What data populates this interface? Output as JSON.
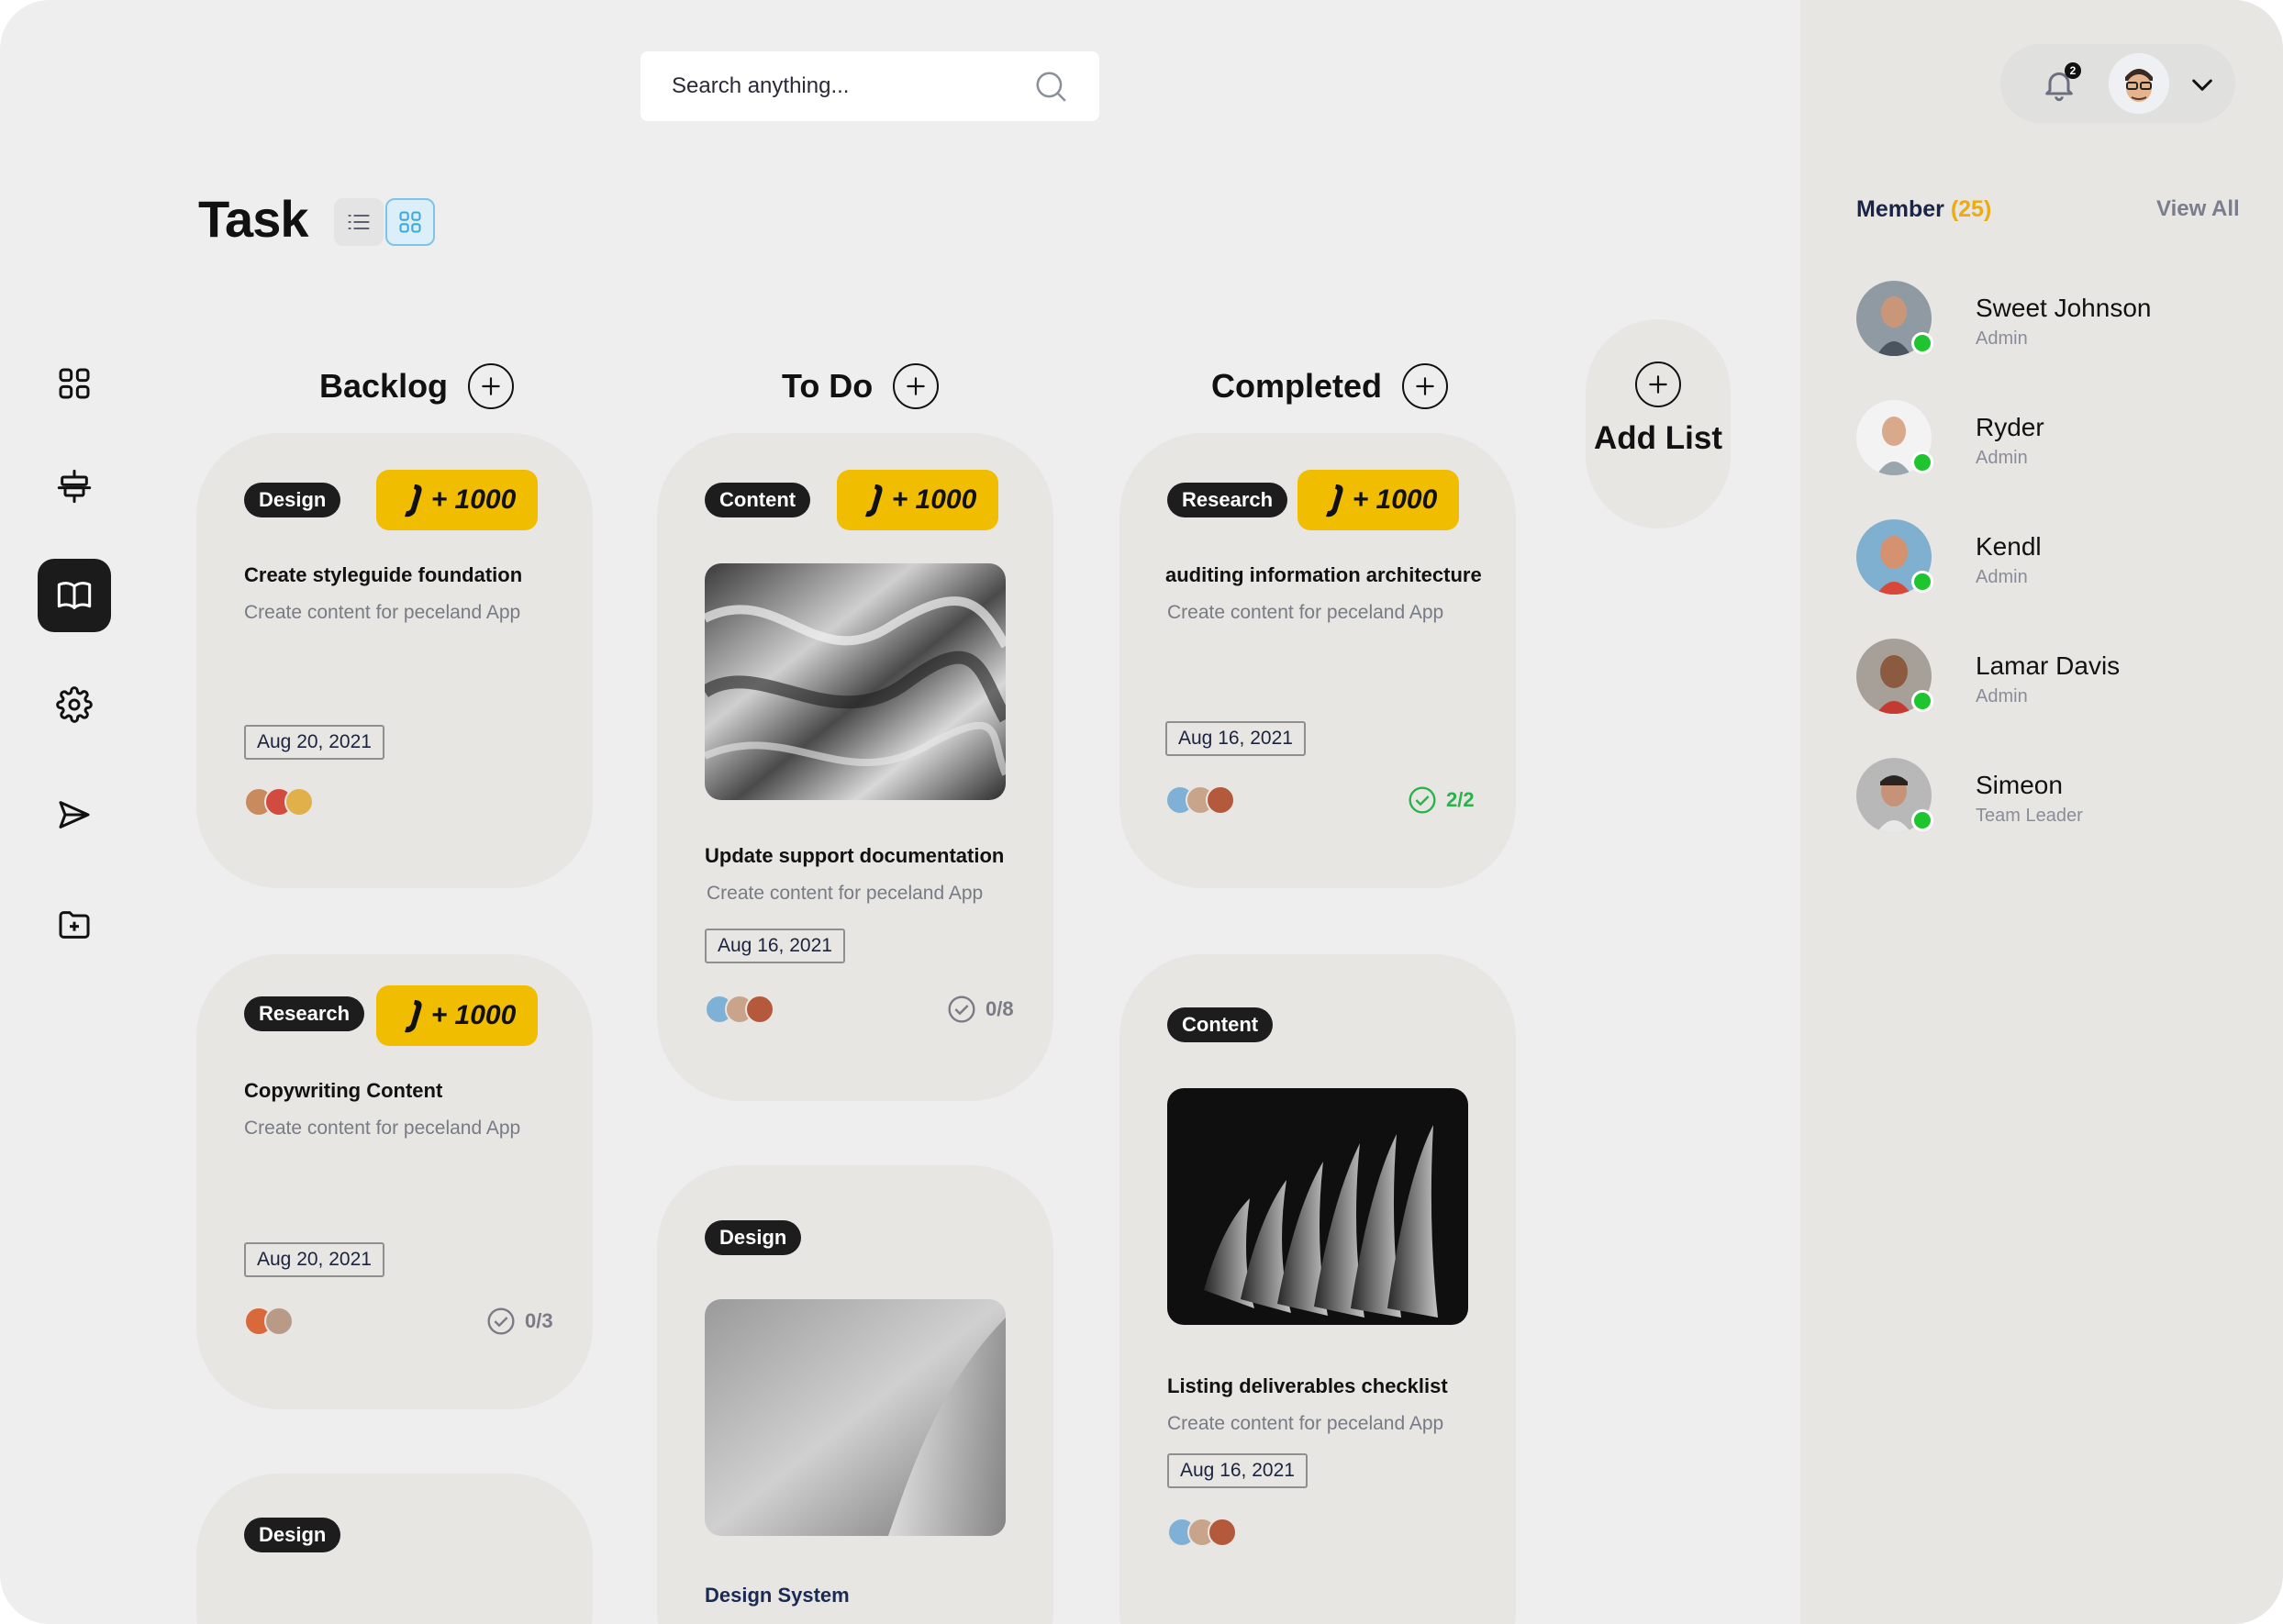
{
  "search": {
    "placeholder": "Search anything..."
  },
  "page": {
    "title": "Task"
  },
  "sidebar": {
    "items": [
      {
        "icon": "dashboard-icon"
      },
      {
        "icon": "align-icon"
      },
      {
        "icon": "book-icon",
        "active": true
      },
      {
        "icon": "gear-icon"
      },
      {
        "icon": "send-icon"
      },
      {
        "icon": "folder-add-icon"
      }
    ]
  },
  "columns": [
    {
      "title": "Backlog"
    },
    {
      "title": "To Do"
    },
    {
      "title": "Completed"
    }
  ],
  "add_list": {
    "label": "Add List"
  },
  "badge": {
    "label": "+ 1000"
  },
  "cards": {
    "backlog_1": {
      "tag": "Design",
      "title": "Create styleguide foundation",
      "subtitle": "Create content for peceland App",
      "date": "Aug 20, 2021"
    },
    "backlog_2": {
      "tag": "Research",
      "title": "Copywriting Content",
      "subtitle": "Create content for peceland App",
      "date": "Aug 20, 2021",
      "checklist": "0/3"
    },
    "backlog_3": {
      "tag": "Design"
    },
    "todo_1": {
      "tag": "Content",
      "title": "Update support documentation",
      "subtitle": "Create content for peceland App",
      "date": "Aug 16, 2021",
      "checklist": "0/8"
    },
    "todo_2": {
      "tag": "Design",
      "title": "Design System"
    },
    "completed_1": {
      "tag": "Research",
      "title": "auditing information architecture",
      "subtitle": "Create content for peceland App",
      "date": "Aug 16, 2021",
      "checklist": "2/2"
    },
    "completed_2": {
      "tag": "Content",
      "title": "Listing deliverables checklist",
      "subtitle": "Create content for peceland App",
      "date": "Aug 16, 2021"
    }
  },
  "header": {
    "notifications": "2"
  },
  "members": {
    "label": "Member",
    "count": "(25)",
    "view_all": "View All",
    "list": [
      {
        "name": "Sweet Johnson",
        "role": "Admin"
      },
      {
        "name": "Ryder",
        "role": "Admin"
      },
      {
        "name": "Kendl",
        "role": "Admin"
      },
      {
        "name": "Lamar Davis",
        "role": "Admin"
      },
      {
        "name": "Simeon",
        "role": "Team Leader"
      }
    ]
  },
  "colors": {
    "accent_yellow": "#F1BD00",
    "online": "#1EC52E",
    "done": "#29B34A",
    "active_nav": "#1B1B1B"
  }
}
